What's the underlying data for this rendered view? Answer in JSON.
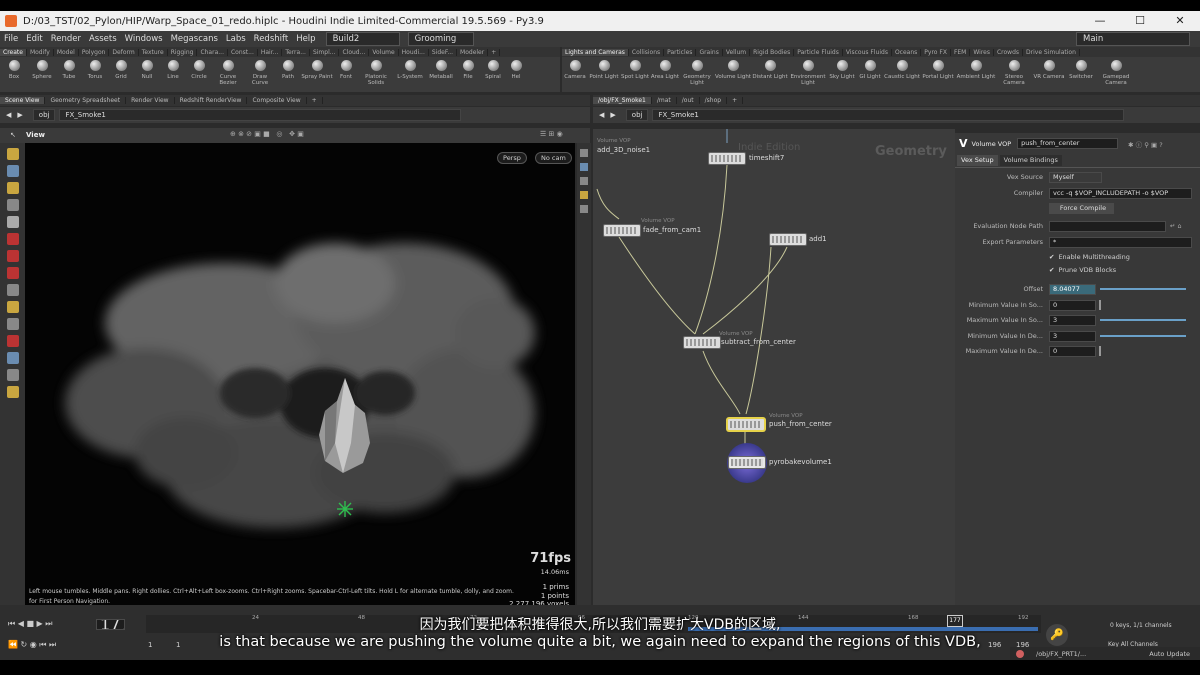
{
  "window": {
    "title": "D:/03_TST/02_Pylon/HIP/Warp_Space_01_redo.hiplc - Houdini Indie Limited-Commercial 19.5.569 - Py3.9",
    "controls": [
      "—",
      "☐",
      "✕"
    ]
  },
  "menubar": {
    "items": [
      "File",
      "Edit",
      "Render",
      "Assets",
      "Windows",
      "Megascans",
      "Labs",
      "Redshift",
      "Help"
    ],
    "build": "Build2",
    "desktop": "Grooming",
    "right": "Main"
  },
  "shelf_left": {
    "tabs": [
      "Create",
      "Modify",
      "Model",
      "Polygon",
      "Deform",
      "Texture",
      "Rigging",
      "Chara...",
      "Const...",
      "Hair...",
      "Terra...",
      "Simpl...",
      "Cloud...",
      "Volume",
      "Houdi...",
      "SideF...",
      "Modeler"
    ],
    "tools": [
      "Box",
      "Sphere",
      "Tube",
      "Torus",
      "Grid",
      "Null",
      "Line",
      "Circle",
      "Curve Bezier",
      "Draw Curve",
      "Path",
      "Spray Paint",
      "Font",
      "Platonic Solids",
      "L-System",
      "Metaball",
      "File",
      "Spiral",
      "Hel"
    ]
  },
  "shelf_right": {
    "tabs": [
      "Lights and Cameras",
      "Collisions",
      "Particles",
      "Grains",
      "Vellum",
      "Rigid Bodies",
      "Particle Fluids",
      "Viscous Fluids",
      "Oceans",
      "Pyro FX",
      "FEM",
      "Wires",
      "Crowds",
      "Drive Simulation"
    ],
    "tools": [
      "Camera",
      "Point Light",
      "Spot Light",
      "Area Light",
      "Geometry Light",
      "Volume Light",
      "Distant Light",
      "Environment Light",
      "Sky Light",
      "GI Light",
      "Caustic Light",
      "Portal Light",
      "Ambient Light",
      "Stereo Camera",
      "VR Camera",
      "Switcher",
      "Gamepad Camera"
    ]
  },
  "left_pane": {
    "tabs": [
      "Scene View",
      "Geometry Spreadsheet",
      "Render View",
      "Redshift RenderView",
      "Composite View"
    ],
    "path": [
      "obj",
      "FX_Smoke1"
    ],
    "view_label": "View",
    "persp": "Persp",
    "cam": "No cam",
    "help_text": "Left mouse tumbles. Middle pans. Right dollies. Ctrl+Alt+Left box-zooms. Ctrl+Right zooms. Spacebar-Ctrl-Left tilts. Hold L for alternate tumble, dolly, and zoom.",
    "help_text2": "for First Person Navigation.",
    "fps": "71fps",
    "ms": "14.06ms",
    "prims": "1  prims",
    "points": "1 points",
    "voxels": "2,277,196  voxels"
  },
  "right_pane": {
    "tabs": [
      "/obj/FX_Smoke1",
      "/mat",
      "/out",
      "/shop"
    ],
    "path": [
      "obj",
      "FX_Smoke1"
    ],
    "watermark": "Indie Edition",
    "context": "Geometry",
    "nodes": [
      {
        "type": "Volume VOP",
        "name": "add_3D_noise1"
      },
      {
        "type": "",
        "name": "timeshift7"
      },
      {
        "type": "Volume VOP",
        "name": "fade_from_cam1"
      },
      {
        "type": "",
        "name": "add1"
      },
      {
        "type": "Volume VOP",
        "name": "subtract_from_center"
      },
      {
        "type": "Volume VOP",
        "name": "push_from_center"
      },
      {
        "type": "",
        "name": "pyrobakevolume1"
      }
    ]
  },
  "params": {
    "op_type": "Volume VOP",
    "op_name": "push_from_center",
    "tabs": [
      "Vex Setup",
      "Volume Bindings"
    ],
    "vex_source_label": "Vex Source",
    "vex_source": "Myself",
    "compiler_label": "Compiler",
    "compiler": "vcc -q $VOP_INCLUDEPATH -o $VOP",
    "force_compile": "Force Compile",
    "eval_path_label": "Evaluation Node Path",
    "export_label": "Export Parameters",
    "export_value": "*",
    "multithread": "Enable Multithreading",
    "prune": "Prune VDB Blocks",
    "offset_label": "Offset",
    "offset": "8.04077",
    "min_src_label": "Minimum Value In So...",
    "min_src": "0",
    "max_src_label": "Maximum Value In So...",
    "max_src": "3",
    "min_dest_label": "Minimum Value In De...",
    "min_dest": "3",
    "max_dest_label": "Maximum Value In De...",
    "max_dest": "0"
  },
  "timeline": {
    "frame": "177",
    "ticks": [
      "24",
      "48",
      "72",
      "96",
      "120",
      "144",
      "168",
      "192"
    ],
    "start": "1",
    "start2": "1",
    "end": "196",
    "end2": "196",
    "keys": "0 keys, 1/1 channels",
    "key_all": "Key All Channels",
    "path": "/obj/FX_PRT1/...",
    "auto_update": "Auto Update"
  },
  "subtitles": {
    "zh": "因为我们要把体积推得很大,所以我们需要扩大VDB的区域,",
    "en": "is that because we are pushing the volume quite a bit, we again need to expand the regions of this VDB,"
  }
}
